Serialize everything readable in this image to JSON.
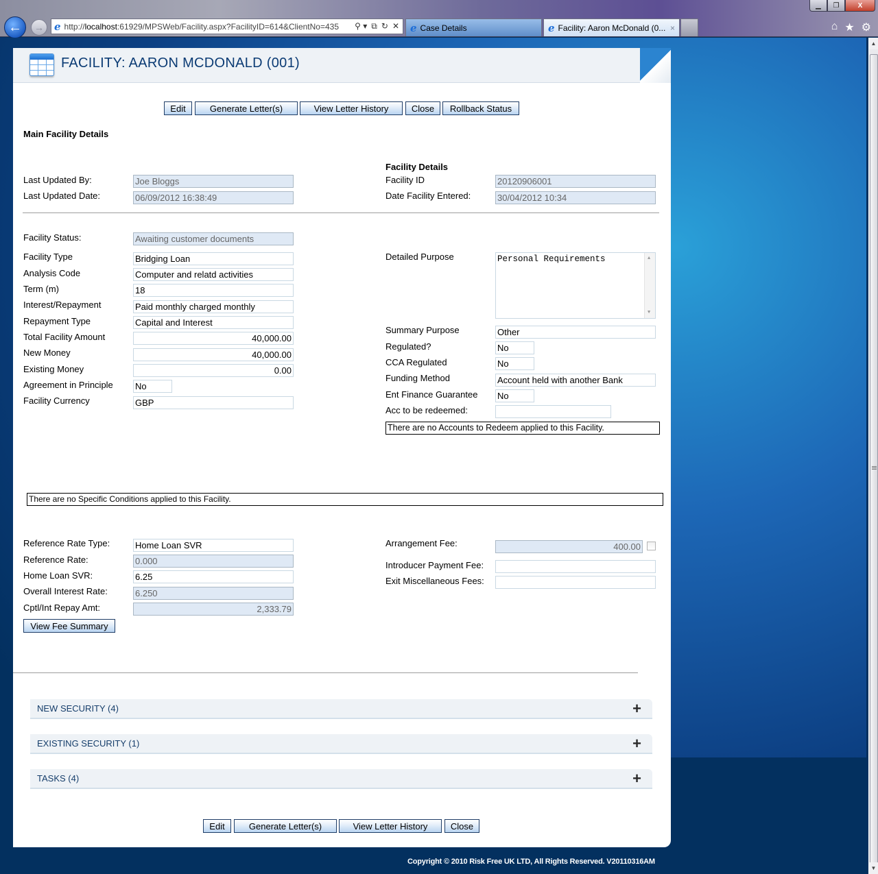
{
  "browser": {
    "url": "http://localhost:61929/MPSWeb/Facility.aspx?FacilityID=614&ClientNo=435",
    "url_prefix": "http://",
    "url_host": "localhost",
    "url_rest": ":61929/MPSWeb/Facility.aspx?FacilityID=614&ClientNo=435",
    "tabs": [
      {
        "label": "Case Details",
        "active": false
      },
      {
        "label": "Facility: Aaron McDonald (0...",
        "active": true
      }
    ],
    "icons": {
      "back": "←",
      "forward": "→",
      "ie": "e",
      "search": "⚲ ▾",
      "compat": "⧉",
      "refresh": "↻",
      "stop": "✕",
      "home": "⌂",
      "favorites": "★",
      "tools": "⚙",
      "minimize": "▁",
      "restore": "❐",
      "close": "X",
      "tab_close": "×"
    }
  },
  "page": {
    "title": "FACILITY: AARON MCDONALD (001)",
    "top_buttons": {
      "edit": "Edit",
      "generate_letters": "Generate Letter(s)",
      "view_letter_history": "View Letter History",
      "close": "Close",
      "rollback_status": "Rollback Status"
    },
    "section_title": "Main Facility Details",
    "audit": {
      "last_updated_by_label": "Last Updated By:",
      "last_updated_by": "Joe Bloggs",
      "last_updated_date_label": "Last Updated Date:",
      "last_updated_date": "06/09/2012 16:38:49"
    },
    "facility_details": {
      "heading": "Facility Details",
      "facility_id_label": "Facility ID",
      "facility_id": "20120906001",
      "date_entered_label": "Date Facility Entered:",
      "date_entered": "30/04/2012 10:34"
    },
    "left_fields": [
      {
        "label": "Facility Status:",
        "value": "Awaiting customer documents"
      },
      {
        "label": "Facility Type",
        "value": "Bridging Loan"
      },
      {
        "label": "Analysis Code",
        "value": "Computer and relatd activities"
      },
      {
        "label": "Term (m)",
        "value": "18"
      },
      {
        "label": "Interest/Repayment",
        "value": "Paid monthly charged monthly"
      },
      {
        "label": "Repayment Type",
        "value": "Capital and Interest"
      },
      {
        "label": "Total Facility Amount",
        "value": "40,000.00"
      },
      {
        "label": "New Money",
        "value": "40,000.00"
      },
      {
        "label": "Existing Money",
        "value": "0.00"
      },
      {
        "label": "Agreement in Principle",
        "value": "No"
      },
      {
        "label": "Facility Currency",
        "value": "GBP"
      }
    ],
    "right_fields": {
      "detailed_purpose_label": "Detailed Purpose",
      "detailed_purpose": "Personal Requirements",
      "summary_purpose_label": "Summary Purpose",
      "summary_purpose": "Other",
      "regulated_label": "Regulated?",
      "regulated": "No",
      "cca_regulated_label": "CCA Regulated",
      "cca_regulated": "No",
      "funding_method_label": "Funding Method",
      "funding_method": "Account held with another Bank",
      "ent_finance_label": "Ent Finance Guarantee",
      "ent_finance": "No",
      "acc_redeemed_label": "Acc to be redeemed:",
      "acc_redeemed": "",
      "no_accounts_msg": "There are no Accounts to Redeem applied to this Facility."
    },
    "no_conditions_msg": "There are no Specific Conditions applied to this Facility.",
    "rates": [
      {
        "label": "Reference Rate Type:",
        "value": "Home Loan SVR"
      },
      {
        "label": "Reference Rate:",
        "value": "0.000"
      },
      {
        "label": "Home Loan SVR:",
        "value": "6.25"
      },
      {
        "label": "Overall Interest Rate:",
        "value": "6.250"
      },
      {
        "label": "Cptl/Int Repay Amt:",
        "value": "2,333.79"
      }
    ],
    "view_fee_summary": "View Fee Summary",
    "fees": {
      "arrangement_label": "Arrangement Fee:",
      "arrangement": "400.00",
      "arrangement_checked": false,
      "introducer_label": "Introducer Payment Fee:",
      "introducer": "",
      "exit_misc_label": "Exit Miscellaneous Fees:",
      "exit_misc": ""
    },
    "accordions": [
      {
        "label": "NEW SECURITY (4)",
        "icon": "+"
      },
      {
        "label": "EXISTING SECURITY (1)",
        "icon": "+"
      },
      {
        "label": "TASKS (4)",
        "icon": "+"
      }
    ],
    "bottom_buttons": {
      "edit": "Edit",
      "generate_letters": "Generate Letter(s)",
      "view_letter_history": "View Letter History",
      "close": "Close"
    },
    "footer": "Copyright © 2010 Risk Free UK LTD, All Rights Reserved. V20110316AM"
  }
}
